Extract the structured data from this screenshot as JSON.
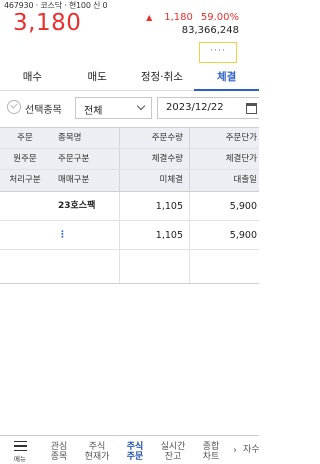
{
  "header": {
    "stock_info": "467930 · 코스닥 · 현100 신 0",
    "price": "3,180",
    "change_arrow": "▲",
    "change": "1,180",
    "change_pct": "59.00%",
    "volume": "83,366,248",
    "more_label": "····"
  },
  "tabs": [
    {
      "label": "매수"
    },
    {
      "label": "매도"
    },
    {
      "label": "정정·취소"
    },
    {
      "label": "체결"
    }
  ],
  "filter": {
    "checkbox_label": "선택종목",
    "select_value": "전체",
    "date_value": "2023/12/22"
  },
  "table": {
    "headers": [
      [
        "주문",
        "종목명",
        "주문수량",
        "주문단가"
      ],
      [
        "원주문",
        "주문구분",
        "체결수량",
        "체결단가"
      ],
      [
        "처리구분",
        "매매구분",
        "미체결",
        "대출일"
      ]
    ],
    "rows": [
      {
        "c1": "",
        "c2": "23호스팩",
        "c3": "1,105",
        "c4": "5,900"
      },
      {
        "c1": "",
        "c2": "⋮",
        "c3": "1,105",
        "c4": "5,900"
      }
    ]
  },
  "bottom_nav": {
    "menu_label": "메뉴",
    "items": [
      {
        "label": "관심\n종목"
      },
      {
        "label": "주식\n현재가"
      },
      {
        "label": "주식\n주문"
      },
      {
        "label": "실시간\n잔고"
      },
      {
        "label": "종합\n차트"
      }
    ],
    "arrow": "›",
    "last_item": "자수"
  },
  "colors": {
    "up": "#e8302f",
    "accent": "#2b61c4",
    "more_border": "#f2cf45"
  }
}
